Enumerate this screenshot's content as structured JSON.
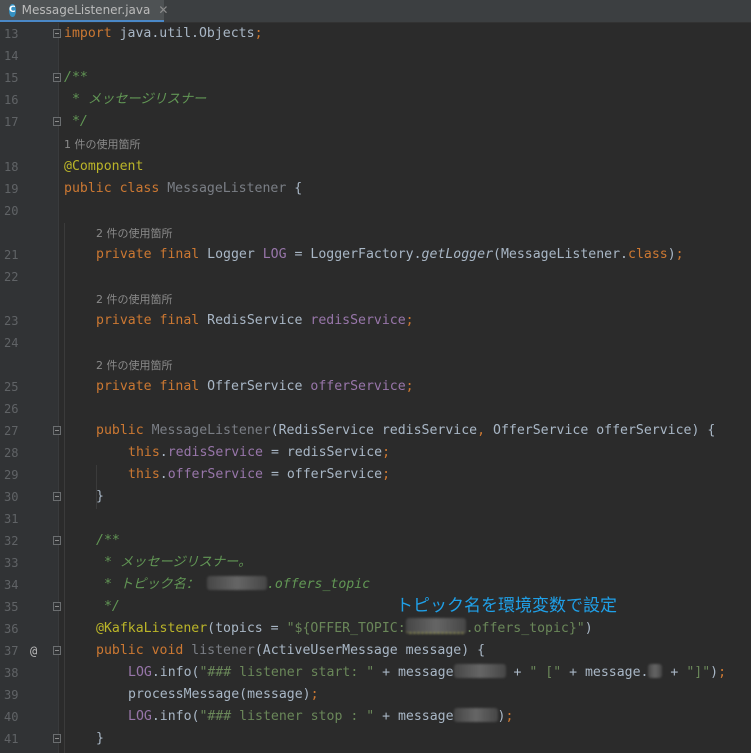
{
  "tab": {
    "icon": "C",
    "title": "MessageListener.java",
    "close": "✕"
  },
  "hints": {
    "h1": "1 件の使用箇所",
    "h2": "2 件の使用箇所",
    "h3": "2 件の使用箇所",
    "h4": "2 件の使用箇所"
  },
  "annotation_note": "トピック名を環境変数で設定",
  "colors": {
    "background": "#2b2b2b",
    "keyword": "#cc7832",
    "annotation": "#bbb529",
    "doc_comment": "#629755",
    "field": "#9876aa",
    "string": "#6a8759",
    "note": "#1fa0e8"
  },
  "lines": [
    {
      "n": "13",
      "t": [
        [
          "import",
          "kw"
        ],
        [
          " java.util.Objects",
          ""
        ],
        [
          ";",
          "kw"
        ]
      ]
    },
    {
      "n": "14",
      "t": []
    },
    {
      "n": "15",
      "t": [
        [
          "/**",
          "doc"
        ]
      ]
    },
    {
      "n": "16",
      "t": [
        [
          " * メッセージリスナー",
          "doc"
        ]
      ]
    },
    {
      "n": "17",
      "t": [
        [
          " */",
          "doc"
        ]
      ]
    },
    {
      "n": "18",
      "t": [
        [
          "@Component",
          "ann"
        ]
      ]
    },
    {
      "n": "19",
      "t": [
        [
          "public class ",
          "kw"
        ],
        [
          "MessageListener",
          "dim"
        ],
        [
          " {",
          ""
        ]
      ]
    },
    {
      "n": "20",
      "t": []
    },
    {
      "n": "21",
      "t": [
        [
          "private final ",
          "kw"
        ],
        [
          "Logger ",
          ""
        ],
        [
          "LOG",
          "fld"
        ],
        [
          " = LoggerFactory.",
          ""
        ],
        [
          "getLogger",
          "mth"
        ],
        [
          "(MessageListener.",
          ""
        ],
        [
          "class",
          "kw"
        ],
        [
          ")",
          ""
        ],
        [
          ";",
          "kw"
        ]
      ]
    },
    {
      "n": "22",
      "t": []
    },
    {
      "n": "23",
      "t": [
        [
          "private final ",
          "kw"
        ],
        [
          "RedisService ",
          ""
        ],
        [
          "redisService",
          "fld"
        ],
        [
          ";",
          "kw"
        ]
      ]
    },
    {
      "n": "24",
      "t": []
    },
    {
      "n": "25",
      "t": [
        [
          "private final ",
          "kw"
        ],
        [
          "OfferService ",
          ""
        ],
        [
          "offerService",
          "fld"
        ],
        [
          ";",
          "kw"
        ]
      ]
    },
    {
      "n": "26",
      "t": []
    },
    {
      "n": "27",
      "t": [
        [
          "public ",
          "kw"
        ],
        [
          "MessageListener",
          "dim"
        ],
        [
          "(RedisService redisService",
          ""
        ],
        [
          ", ",
          "kw"
        ],
        [
          "OfferService offerService) {",
          ""
        ]
      ]
    },
    {
      "n": "28",
      "t": [
        [
          "this",
          "kw"
        ],
        [
          ".",
          ""
        ],
        [
          "redisService",
          "fld"
        ],
        [
          " = redisService",
          ""
        ],
        [
          ";",
          "kw"
        ]
      ]
    },
    {
      "n": "29",
      "t": [
        [
          "this",
          "kw"
        ],
        [
          ".",
          ""
        ],
        [
          "offerService",
          "fld"
        ],
        [
          " = offerService",
          ""
        ],
        [
          ";",
          "kw"
        ]
      ]
    },
    {
      "n": "30",
      "t": [
        [
          "}",
          ""
        ]
      ]
    },
    {
      "n": "31",
      "t": []
    },
    {
      "n": "32",
      "t": [
        [
          "/**",
          "doc"
        ]
      ]
    },
    {
      "n": "33",
      "t": [
        [
          " * メッセージリスナー。",
          "doc"
        ]
      ]
    },
    {
      "n": "34",
      "t": [
        [
          " * トピック名： ",
          "doc"
        ],
        [
          "blur:60",
          "blur"
        ],
        [
          ".offers_topic",
          "doc"
        ]
      ]
    },
    {
      "n": "35",
      "t": [
        [
          " */",
          "doc"
        ]
      ]
    },
    {
      "n": "36",
      "t": [
        [
          "@KafkaListener",
          "ann"
        ],
        [
          "(topics = ",
          ""
        ],
        [
          "\"${OFFER_TOPIC:",
          "str"
        ],
        [
          "blur:60",
          "blur"
        ],
        [
          ".offers_topic}\"",
          "str"
        ],
        [
          ")",
          ""
        ]
      ]
    },
    {
      "n": "37",
      "t": [
        [
          "public void ",
          "kw"
        ],
        [
          "listener",
          "dim"
        ],
        [
          "(ActiveUserMessage message) {",
          ""
        ]
      ]
    },
    {
      "n": "38",
      "t": [
        [
          "LOG",
          "fld"
        ],
        [
          ".info(",
          ""
        ],
        [
          "\"### listener start: \"",
          "str"
        ],
        [
          " + message",
          ""
        ],
        [
          "blur:52",
          "blur"
        ],
        [
          " + ",
          ""
        ],
        [
          "\" [\"",
          "str"
        ],
        [
          " + message.",
          ""
        ],
        [
          "blur:14",
          "blur"
        ],
        [
          " + ",
          ""
        ],
        [
          "\"]\"",
          "str"
        ],
        [
          ")",
          ""
        ],
        [
          ";",
          "kw"
        ]
      ]
    },
    {
      "n": "39",
      "t": [
        [
          "processMessage(message)",
          ""
        ],
        [
          ";",
          "kw"
        ]
      ]
    },
    {
      "n": "40",
      "t": [
        [
          "LOG",
          "fld"
        ],
        [
          ".info(",
          ""
        ],
        [
          "\"### listener stop : \"",
          "str"
        ],
        [
          " + message",
          ""
        ],
        [
          "blur:44",
          "blur"
        ],
        [
          ")",
          ""
        ],
        [
          ";",
          "kw"
        ]
      ]
    },
    {
      "n": "41",
      "t": [
        [
          "}",
          ""
        ]
      ]
    }
  ]
}
